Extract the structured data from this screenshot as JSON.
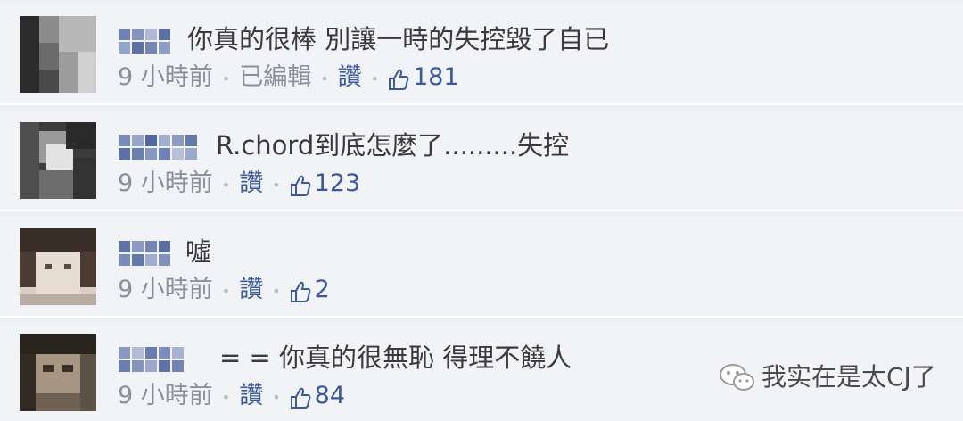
{
  "comments": [
    {
      "text": "你真的很棒 別讓一時的失控毀了自已",
      "time": "9 小時前",
      "edited": "已編輯",
      "like_label": "讚",
      "like_count": "181"
    },
    {
      "text": "R.chord到底怎麼了.........失控",
      "time": "9 小時前",
      "like_label": "讚",
      "like_count": "123"
    },
    {
      "text": "噓",
      "time": "9 小時前",
      "like_label": "讚",
      "like_count": "2"
    },
    {
      "text": "= = 你真的很無恥 得理不饒人",
      "time": "9 小時前",
      "like_label": "讚",
      "like_count": "84"
    }
  ],
  "icons": {
    "thumb": "thumbs-up-icon",
    "watermark": "wechat-icon"
  },
  "colors": {
    "background": "#edeff4",
    "link": "#3b5998",
    "meta": "#8a8f99"
  },
  "watermark": {
    "text": "我实在是太CJ了"
  }
}
